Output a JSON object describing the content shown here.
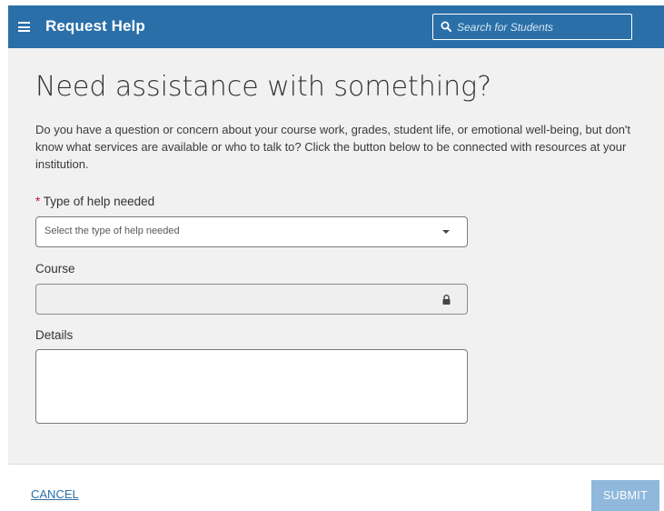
{
  "header": {
    "title": "Request Help",
    "search_placeholder": "Search for Students",
    "menu_icon": "hamburger-menu-icon",
    "search_icon": "magnifier-icon",
    "background_color": "#2a6fa8"
  },
  "main": {
    "heading": "Need assistance with something?",
    "intro": "Do you have a question or concern about your course work, grades, student life, or emotional well-being, but don't know what services are available or who to talk to? Click the button below to be connected with resources at your institution.",
    "help_type": {
      "required_marker": "*",
      "label": "Type of help needed",
      "placeholder": "Select the type of help needed",
      "icon": "caret-down-icon"
    },
    "course": {
      "label": "Course",
      "value": "",
      "locked": true,
      "icon": "lock-icon"
    },
    "details": {
      "label": "Details",
      "value": ""
    }
  },
  "footer": {
    "cancel_label": "CANCEL",
    "submit_label": "SUBMIT",
    "submit_color": "#8fb8dc"
  }
}
